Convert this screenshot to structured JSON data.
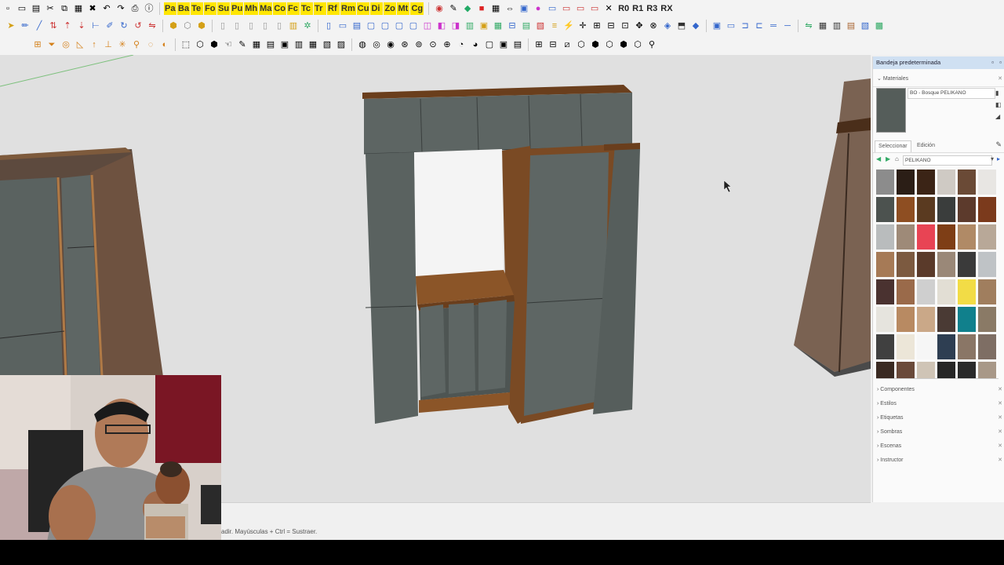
{
  "toolbar": {
    "row1_tabs": [
      "Pa",
      "Ba",
      "Te",
      "Fo",
      "Su",
      "Pu",
      "Mh",
      "Ma",
      "Co",
      "Fc",
      "Tc",
      "Tr",
      "Rf",
      "Rm",
      "Cu",
      "Di",
      "Zo",
      "Mt",
      "Cg"
    ],
    "right_tabs": [
      "R0",
      "R1",
      "R3",
      "RX"
    ]
  },
  "tray": {
    "title": "Bandeja predeterminada",
    "materials_label": "Materiales",
    "material_name": "BO - Bosque PELIKANO",
    "tab_select": "Seleccionar",
    "tab_edit": "Edición",
    "library": "PELIKANO",
    "swatches": [
      "#8c8c8c",
      "#2b1e16",
      "#3b2416",
      "#cfcac4",
      "#6a4a36",
      "#e8e6e3",
      "#4c524f",
      "#8e4e22",
      "#5a3a20",
      "#3a3d3c",
      "#5c3a2c",
      "#7b3a1c",
      "#b9bcbd",
      "#9e8a78",
      "#e84454",
      "#7e3e16",
      "#b08a66",
      "#b8a898",
      "#a67a56",
      "#7c5a40",
      "#5a3a2a",
      "#9a8878",
      "#3a3a3a",
      "#bfc3c6",
      "#4a3230",
      "#9a6a4a",
      "#cfcfcf",
      "#e2ded4",
      "#f2dc46",
      "#a07e5e",
      "#e6e4de",
      "#b88a62",
      "#caa888",
      "#4a3a34",
      "#10808c",
      "#8a7a66",
      "#404040",
      "#ece6d8",
      "#f6f6f6",
      "#2e3e52",
      "#8a7666",
      "#7e6e64",
      "#3a2a22",
      "#6a4a3a",
      "#cfc4b6",
      "#262626",
      "#2a2a2a",
      "#a89888"
    ],
    "sections": [
      "Componentes",
      "Estilos",
      "Etiquetas",
      "Sombras",
      "Escenas",
      "Instructor"
    ]
  },
  "status": {
    "hint": "adir. Mayúsculas + Ctrl = Sustraer."
  },
  "colors": {
    "stone": "#5c6462",
    "wood": "#7a4a24",
    "tray_header": "#cfe0f2",
    "viewport_bg": "#e0e0e0"
  }
}
